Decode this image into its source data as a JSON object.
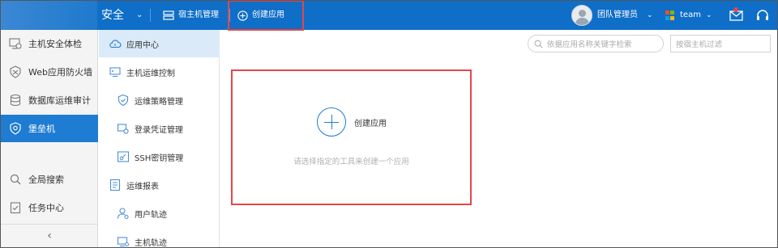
{
  "topbar": {
    "product": "安全",
    "host_manage": "宿主机管理",
    "create_app": "创建应用",
    "user_role": "团队管理员",
    "team": "team"
  },
  "sidebar1": {
    "items": [
      {
        "label": "主机安全体检",
        "icon": "host-check-icon"
      },
      {
        "label": "Web应用防火墙",
        "icon": "firewall-icon"
      },
      {
        "label": "数据库运维审计",
        "icon": "database-icon"
      },
      {
        "label": "堡垒机",
        "icon": "shield-icon",
        "active": true
      },
      {
        "label": "全局搜索",
        "icon": "search-icon"
      },
      {
        "label": "任务中心",
        "icon": "task-icon"
      }
    ]
  },
  "sidebar2": {
    "items": [
      {
        "label": "应用中心",
        "icon": "cloud-icon",
        "active": true
      },
      {
        "label": "主机运维控制",
        "icon": "host-control-icon"
      },
      {
        "label": "运维策略管理",
        "icon": "policy-shield-icon"
      },
      {
        "label": "登录凭证管理",
        "icon": "credential-icon"
      },
      {
        "label": "SSH密钥管理",
        "icon": "key-icon"
      },
      {
        "label": "运维报表",
        "icon": "report-icon"
      },
      {
        "label": "用户轨迹",
        "icon": "user-track-icon"
      },
      {
        "label": "主机轨迹",
        "icon": "host-track-icon"
      }
    ]
  },
  "toolbar": {
    "search_placeholder": "依据应用名称关键字检索",
    "filter_placeholder": "按宿主机过滤"
  },
  "create_card": {
    "label": "创建应用",
    "hint": "请选择指定的工具来创建一个应用"
  },
  "colors": {
    "header_blue": "#0f6ec8",
    "active_blue": "#1e7cd2",
    "highlight_red": "#e2474b"
  }
}
